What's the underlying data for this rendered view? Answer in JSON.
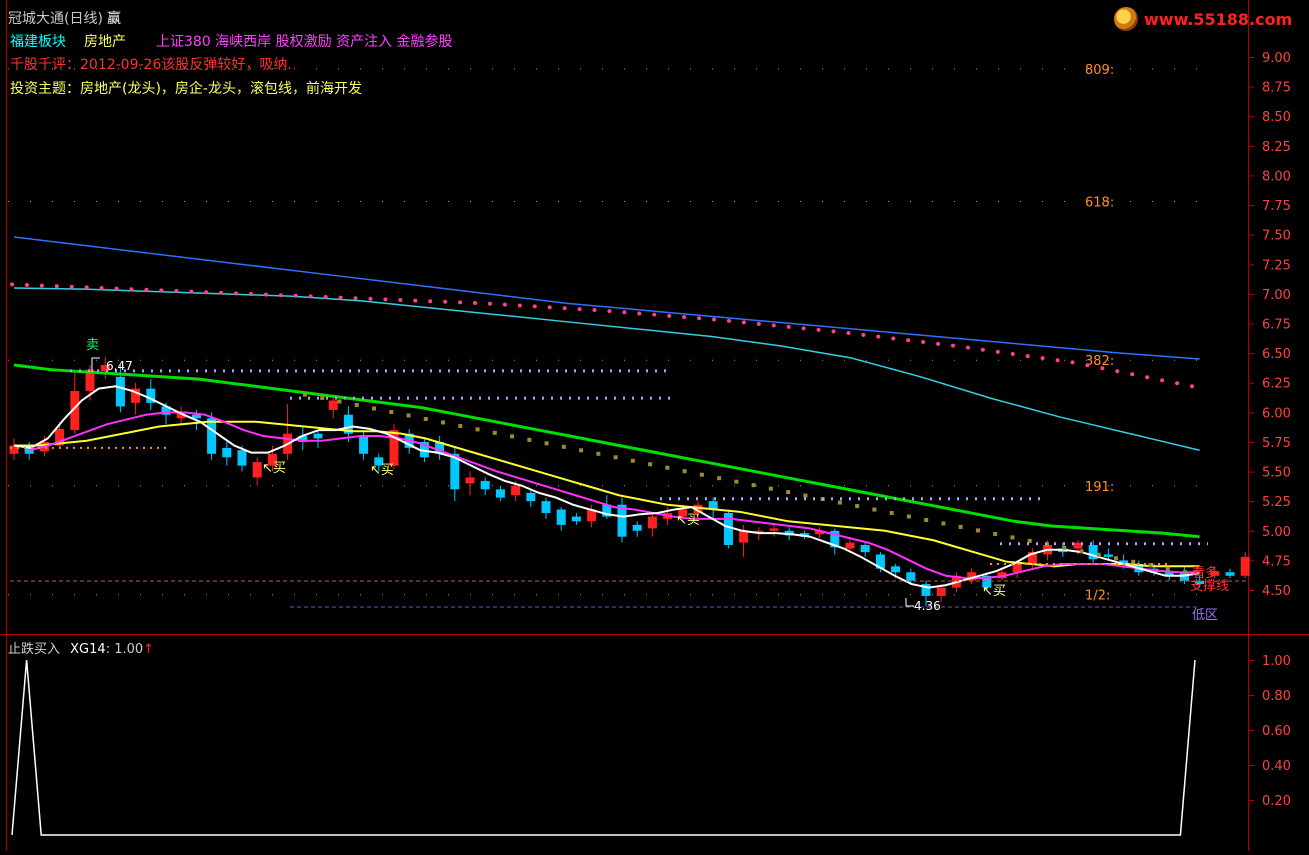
{
  "header": {
    "title": "冠城大通(日线)",
    "title_tag": "赢",
    "sector": "福建板块",
    "industry": "房地产",
    "concepts": "上证380 海峡西岸 股权激励 资产注入 金融参股",
    "comment": "千股千评：2012-09-26该股反弹较好，吸纳.",
    "theme": "投资主题：房地产(龙头)，房企-龙头，滚包线，前海开发"
  },
  "logo": {
    "text": "www.55188.com"
  },
  "colors": {
    "background": "#000000",
    "grid": "#b00000",
    "up_candle": "#ff2020",
    "down_candle": "#00c8ff",
    "white_line": "#ffffff",
    "magenta_line": "#ff30ff",
    "yellow_line": "#ffff30",
    "green_line": "#00e000",
    "blue_line": "#3070ff",
    "cyan_line": "#30d0e0",
    "pink_dots": "#ff4090",
    "lavender": "#b0a0ff",
    "orange": "#ff9020"
  },
  "chart_data": [
    {
      "type": "candlestick",
      "y_ticks": [
        "9.00",
        "8.75",
        "8.50",
        "8.25",
        "8.00",
        "7.75",
        "7.50",
        "7.25",
        "7.00",
        "6.75",
        "6.50",
        "6.25",
        "6.00",
        "5.75",
        "5.50",
        "5.25",
        "5.00",
        "4.75",
        "4.50"
      ],
      "ylim": [
        4.25,
        9.1
      ],
      "fib_levels": [
        {
          "label": "809:",
          "value": 8.9
        },
        {
          "label": "618:",
          "value": 7.78
        },
        {
          "label": "382:",
          "value": 6.44
        },
        {
          "label": "191:",
          "value": 5.38
        },
        {
          "label": "1/2:",
          "value": 4.46
        }
      ],
      "annotations": [
        {
          "text": "6.47",
          "kind": "high"
        },
        {
          "text": "4.36",
          "kind": "low"
        },
        {
          "text": "买",
          "kind": "buy_signal",
          "count": 4
        },
        {
          "text": "卖",
          "kind": "sell_signal"
        },
        {
          "text": "看多",
          "kind": "label"
        },
        {
          "text": "支撑线",
          "kind": "label"
        },
        {
          "text": "低区",
          "kind": "label"
        }
      ],
      "candles": [
        {
          "o": 5.65,
          "c": 5.72,
          "h": 5.78,
          "l": 5.6
        },
        {
          "o": 5.72,
          "c": 5.65,
          "h": 5.75,
          "l": 5.6
        },
        {
          "o": 5.67,
          "c": 5.75,
          "h": 5.8,
          "l": 5.63
        },
        {
          "o": 5.72,
          "c": 5.86,
          "h": 5.92,
          "l": 5.7
        },
        {
          "o": 5.85,
          "c": 6.18,
          "h": 6.35,
          "l": 5.82
        },
        {
          "o": 6.18,
          "c": 6.36,
          "h": 6.4,
          "l": 6.1
        },
        {
          "o": 6.35,
          "c": 6.4,
          "h": 6.47,
          "l": 6.28
        },
        {
          "o": 6.3,
          "c": 6.05,
          "h": 6.4,
          "l": 6.0
        },
        {
          "o": 6.08,
          "c": 6.2,
          "h": 6.25,
          "l": 5.98
        },
        {
          "o": 6.2,
          "c": 6.08,
          "h": 6.28,
          "l": 6.02
        },
        {
          "o": 6.05,
          "c": 5.98,
          "h": 6.08,
          "l": 5.9
        },
        {
          "o": 5.95,
          "c": 6.0,
          "h": 6.05,
          "l": 5.9
        },
        {
          "o": 5.98,
          "c": 5.95,
          "h": 6.02,
          "l": 5.85
        },
        {
          "o": 5.95,
          "c": 5.65,
          "h": 6.0,
          "l": 5.6
        },
        {
          "o": 5.7,
          "c": 5.62,
          "h": 5.75,
          "l": 5.55
        },
        {
          "o": 5.68,
          "c": 5.55,
          "h": 5.72,
          "l": 5.5
        },
        {
          "o": 5.45,
          "c": 5.58,
          "h": 5.62,
          "l": 5.38
        },
        {
          "o": 5.55,
          "c": 5.65,
          "h": 5.72,
          "l": 5.5
        },
        {
          "o": 5.65,
          "c": 5.82,
          "h": 6.07,
          "l": 5.6
        },
        {
          "o": 5.8,
          "c": 5.75,
          "h": 5.88,
          "l": 5.68
        },
        {
          "o": 5.82,
          "c": 5.78,
          "h": 5.85,
          "l": 5.7
        },
        {
          "o": 6.02,
          "c": 6.1,
          "h": 6.15,
          "l": 5.95
        },
        {
          "o": 5.98,
          "c": 5.82,
          "h": 6.05,
          "l": 5.75
        },
        {
          "o": 5.8,
          "c": 5.65,
          "h": 5.85,
          "l": 5.6
        },
        {
          "o": 5.62,
          "c": 5.55,
          "h": 5.65,
          "l": 5.5
        },
        {
          "o": 5.55,
          "c": 5.85,
          "h": 5.9,
          "l": 5.52
        },
        {
          "o": 5.82,
          "c": 5.7,
          "h": 5.86,
          "l": 5.65
        },
        {
          "o": 5.75,
          "c": 5.62,
          "h": 5.78,
          "l": 5.58
        },
        {
          "o": 5.75,
          "c": 5.65,
          "h": 5.8,
          "l": 5.6
        },
        {
          "o": 5.65,
          "c": 5.35,
          "h": 5.7,
          "l": 5.25
        },
        {
          "o": 5.4,
          "c": 5.45,
          "h": 5.5,
          "l": 5.3
        },
        {
          "o": 5.42,
          "c": 5.35,
          "h": 5.45,
          "l": 5.3
        },
        {
          "o": 5.35,
          "c": 5.28,
          "h": 5.38,
          "l": 5.25
        },
        {
          "o": 5.3,
          "c": 5.38,
          "h": 5.42,
          "l": 5.25
        },
        {
          "o": 5.32,
          "c": 5.25,
          "h": 5.35,
          "l": 5.2
        },
        {
          "o": 5.25,
          "c": 5.15,
          "h": 5.28,
          "l": 5.1
        },
        {
          "o": 5.18,
          "c": 5.05,
          "h": 5.2,
          "l": 5.0
        },
        {
          "o": 5.12,
          "c": 5.08,
          "h": 5.15,
          "l": 5.05
        },
        {
          "o": 5.08,
          "c": 5.18,
          "h": 5.22,
          "l": 5.03
        },
        {
          "o": 5.22,
          "c": 5.12,
          "h": 5.3,
          "l": 5.1
        },
        {
          "o": 5.22,
          "c": 4.95,
          "h": 5.28,
          "l": 4.9
        },
        {
          "o": 5.05,
          "c": 5.0,
          "h": 5.08,
          "l": 4.95
        },
        {
          "o": 5.02,
          "c": 5.12,
          "h": 5.15,
          "l": 4.95
        },
        {
          "o": 5.1,
          "c": 5.15,
          "h": 5.2,
          "l": 5.05
        },
        {
          "o": 5.12,
          "c": 5.18,
          "h": 5.22,
          "l": 5.08
        },
        {
          "o": 5.15,
          "c": 5.22,
          "h": 5.25,
          "l": 5.1
        },
        {
          "o": 5.25,
          "c": 5.18,
          "h": 5.28,
          "l": 5.1
        },
        {
          "o": 5.15,
          "c": 4.88,
          "h": 5.18,
          "l": 4.85
        },
        {
          "o": 4.9,
          "c": 5.0,
          "h": 5.05,
          "l": 4.78
        },
        {
          "o": 4.98,
          "c": 5.0,
          "h": 5.03,
          "l": 4.92
        },
        {
          "o": 5.0,
          "c": 5.02,
          "h": 5.05,
          "l": 4.95
        },
        {
          "o": 5.0,
          "c": 4.96,
          "h": 5.03,
          "l": 4.92
        },
        {
          "o": 4.98,
          "c": 4.95,
          "h": 5.0,
          "l": 4.93
        },
        {
          "o": 4.97,
          "c": 5.0,
          "h": 5.03,
          "l": 4.94
        },
        {
          "o": 5.0,
          "c": 4.86,
          "h": 5.02,
          "l": 4.8
        },
        {
          "o": 4.85,
          "c": 4.9,
          "h": 4.95,
          "l": 4.82
        },
        {
          "o": 4.88,
          "c": 4.82,
          "h": 4.9,
          "l": 4.78
        },
        {
          "o": 4.8,
          "c": 4.68,
          "h": 4.82,
          "l": 4.65
        },
        {
          "o": 4.7,
          "c": 4.65,
          "h": 4.72,
          "l": 4.6
        },
        {
          "o": 4.65,
          "c": 4.58,
          "h": 4.68,
          "l": 4.55
        },
        {
          "o": 4.55,
          "c": 4.45,
          "h": 4.58,
          "l": 4.36
        },
        {
          "o": 4.45,
          "c": 4.52,
          "h": 4.55,
          "l": 4.4
        },
        {
          "o": 4.52,
          "c": 4.62,
          "h": 4.65,
          "l": 4.48
        },
        {
          "o": 4.58,
          "c": 4.65,
          "h": 4.68,
          "l": 4.55
        },
        {
          "o": 4.62,
          "c": 4.52,
          "h": 4.65,
          "l": 4.5
        },
        {
          "o": 4.6,
          "c": 4.65,
          "h": 4.68,
          "l": 4.58
        },
        {
          "o": 4.65,
          "c": 4.72,
          "h": 4.75,
          "l": 4.6
        },
        {
          "o": 4.72,
          "c": 4.82,
          "h": 4.85,
          "l": 4.68
        },
        {
          "o": 4.8,
          "c": 4.88,
          "h": 4.92,
          "l": 4.75
        },
        {
          "o": 4.85,
          "c": 4.82,
          "h": 4.9,
          "l": 4.78
        },
        {
          "o": 4.85,
          "c": 4.9,
          "h": 4.92,
          "l": 4.8
        },
        {
          "o": 4.88,
          "c": 4.76,
          "h": 4.92,
          "l": 4.72
        },
        {
          "o": 4.8,
          "c": 4.78,
          "h": 4.85,
          "l": 4.75
        },
        {
          "o": 4.75,
          "c": 4.72,
          "h": 4.8,
          "l": 4.68
        },
        {
          "o": 4.72,
          "c": 4.65,
          "h": 4.75,
          "l": 4.62
        },
        {
          "o": 4.68,
          "c": 4.65,
          "h": 4.72,
          "l": 4.62
        },
        {
          "o": 4.65,
          "c": 4.62,
          "h": 4.68,
          "l": 4.58
        },
        {
          "o": 4.65,
          "c": 4.58,
          "h": 4.7,
          "l": 4.55
        },
        {
          "o": 4.58,
          "c": 4.55,
          "h": 4.62,
          "l": 4.52
        },
        {
          "o": 4.62,
          "c": 4.66,
          "h": 4.7,
          "l": 4.6
        },
        {
          "o": 4.65,
          "c": 4.62,
          "h": 4.68,
          "l": 4.6
        },
        {
          "o": 4.62,
          "c": 4.78,
          "h": 4.82,
          "l": 4.6
        }
      ],
      "lines": {
        "white": [
          5.72,
          5.7,
          5.78,
          5.95,
          6.1,
          6.2,
          6.22,
          6.18,
          6.12,
          6.05,
          5.98,
          5.92,
          5.82,
          5.72,
          5.66,
          5.66,
          5.72,
          5.8,
          5.85,
          5.85,
          5.88,
          5.86,
          5.82,
          5.75,
          5.68,
          5.66,
          5.62,
          5.55,
          5.48,
          5.42,
          5.38,
          5.32,
          5.28,
          5.22,
          5.18,
          5.14,
          5.12,
          5.14,
          5.15,
          5.18,
          5.2,
          5.12,
          5.04,
          5.0,
          4.98,
          4.98,
          4.97,
          4.95,
          4.9,
          4.85,
          4.78,
          4.7,
          4.62,
          4.55,
          4.52,
          4.54,
          4.58,
          4.62,
          4.66,
          4.72,
          4.8,
          4.84,
          4.84,
          4.82,
          4.78,
          4.74,
          4.7,
          4.66,
          4.62,
          4.62,
          4.64
        ],
        "magenta": [
          5.68,
          5.72,
          5.78,
          5.84,
          5.9,
          5.94,
          5.98,
          6.0,
          6.0,
          5.98,
          5.92,
          5.85,
          5.8,
          5.78,
          5.76,
          5.76,
          5.78,
          5.8,
          5.8,
          5.78,
          5.74,
          5.68,
          5.62,
          5.56,
          5.5,
          5.45,
          5.4,
          5.35,
          5.3,
          5.25,
          5.2,
          5.18,
          5.15,
          5.12,
          5.1,
          5.1,
          5.1,
          5.08,
          5.06,
          5.04,
          5.02,
          4.98,
          4.94,
          4.9,
          4.84,
          4.76,
          4.68,
          4.62,
          4.6,
          4.6,
          4.62,
          4.66,
          4.7,
          4.72,
          4.72,
          4.72,
          4.7,
          4.68,
          4.66,
          4.65,
          4.65
        ],
        "yellow": [
          5.72,
          5.72,
          5.74,
          5.76,
          5.8,
          5.84,
          5.88,
          5.9,
          5.92,
          5.92,
          5.92,
          5.9,
          5.88,
          5.86,
          5.84,
          5.84,
          5.82,
          5.78,
          5.72,
          5.66,
          5.6,
          5.54,
          5.48,
          5.42,
          5.36,
          5.3,
          5.26,
          5.22,
          5.2,
          5.18,
          5.16,
          5.12,
          5.08,
          5.06,
          5.04,
          5.02,
          5.0,
          4.96,
          4.92,
          4.86,
          4.8,
          4.74,
          4.72,
          4.7,
          4.72,
          4.72,
          4.72,
          4.7,
          4.7,
          4.7
        ],
        "green": [
          6.4,
          6.36,
          6.34,
          6.32,
          6.3,
          6.28,
          6.24,
          6.2,
          6.16,
          6.12,
          6.08,
          6.04,
          5.98,
          5.92,
          5.86,
          5.8,
          5.74,
          5.68,
          5.62,
          5.56,
          5.5,
          5.44,
          5.38,
          5.32,
          5.26,
          5.2,
          5.14,
          5.08,
          5.04,
          5.02,
          5.0,
          4.98,
          4.95
        ],
        "blue": [
          7.48,
          7.4,
          7.32,
          7.24,
          7.16,
          7.08,
          7.0,
          6.92,
          6.86,
          6.8,
          6.74,
          6.68,
          6.62,
          6.56,
          6.5,
          6.45
        ],
        "cyan": [
          7.05,
          7.04,
          7.02,
          7.0,
          6.98,
          6.94,
          6.88,
          6.82,
          6.76,
          6.7,
          6.64,
          6.56,
          6.46,
          6.3,
          6.12,
          5.96,
          5.82,
          5.68
        ],
        "pink_dots": [
          7.08,
          7.04,
          7.0,
          6.96,
          6.92,
          6.86,
          6.78,
          6.68,
          6.56,
          6.42,
          6.22
        ]
      }
    },
    {
      "type": "line",
      "title": "止跌买入",
      "series": [
        {
          "name": "XG14",
          "value": "1.00"
        }
      ],
      "y_ticks": [
        "1.00",
        "0.80",
        "0.60",
        "0.40",
        "0.20"
      ],
      "ylim": [
        0,
        1.1
      ],
      "values": [
        0,
        1,
        0,
        0,
        0,
        0,
        0,
        0,
        0,
        0,
        0,
        0,
        0,
        0,
        0,
        0,
        0,
        0,
        0,
        0,
        0,
        0,
        0,
        0,
        0,
        0,
        0,
        0,
        0,
        0,
        0,
        0,
        0,
        0,
        0,
        0,
        0,
        0,
        0,
        0,
        0,
        0,
        0,
        0,
        0,
        0,
        0,
        0,
        0,
        0,
        0,
        0,
        0,
        0,
        0,
        0,
        0,
        0,
        0,
        0,
        0,
        0,
        0,
        0,
        0,
        0,
        0,
        0,
        0,
        0,
        0,
        0,
        0,
        0,
        0,
        0,
        0,
        0,
        0,
        0,
        0,
        1
      ]
    }
  ]
}
